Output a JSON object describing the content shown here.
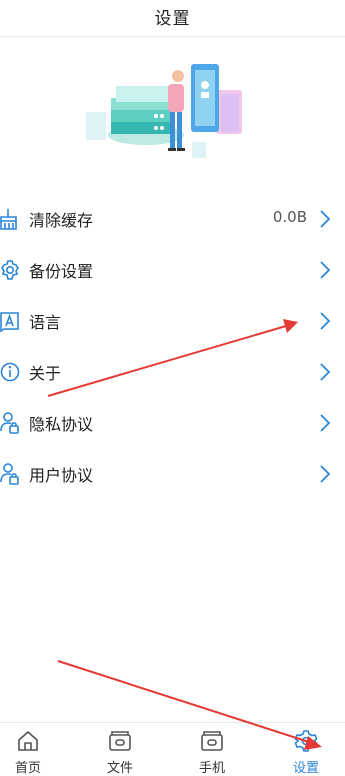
{
  "header": {
    "title": "设置"
  },
  "menu": {
    "items": [
      {
        "label": "清除缓存",
        "value": "0.0B",
        "icon": "broom-icon"
      },
      {
        "label": "备份设置",
        "value": "",
        "icon": "gear-icon"
      },
      {
        "label": "语言",
        "value": "",
        "icon": "language-icon"
      },
      {
        "label": "关于",
        "value": "",
        "icon": "info-icon"
      },
      {
        "label": "隐私协议",
        "value": "",
        "icon": "user-lock-icon"
      },
      {
        "label": "用户协议",
        "value": "",
        "icon": "user-lock-icon"
      }
    ]
  },
  "tabbar": {
    "tabs": [
      {
        "label": "首页",
        "icon": "home-icon"
      },
      {
        "label": "文件",
        "icon": "folder-icon"
      },
      {
        "label": "手机",
        "icon": "phone-transfer-icon"
      },
      {
        "label": "设置",
        "icon": "gear-icon",
        "active": true
      }
    ]
  },
  "colors": {
    "accent": "#2a86d8",
    "annotation": "#e53935"
  }
}
